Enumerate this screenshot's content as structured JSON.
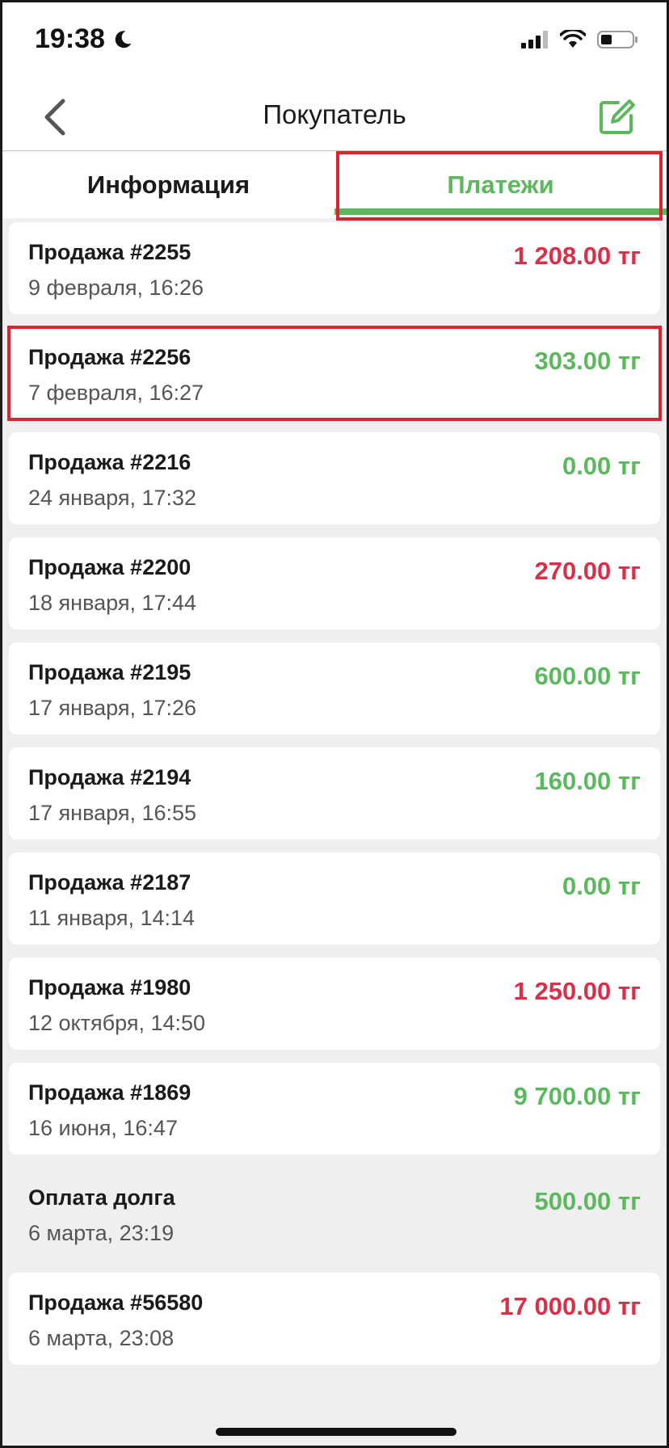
{
  "status_bar": {
    "time": "19:38"
  },
  "nav": {
    "title": "Покупатель"
  },
  "tabs": [
    {
      "label": "Информация",
      "active": false
    },
    {
      "label": "Платежи",
      "active": true
    }
  ],
  "colors": {
    "positive": "#5cb85c",
    "negative": "#d9304a",
    "accent": "#5cb85c",
    "highlight": "#d9252f"
  },
  "payments": [
    {
      "title": "Продажа #2255",
      "date": "9 февраля, 16:26",
      "amount": "1 208.00 тг",
      "status": "negative"
    },
    {
      "title": "Продажа #2256",
      "date": "7 февраля, 16:27",
      "amount": "303.00 тг",
      "status": "positive"
    },
    {
      "title": "Продажа #2216",
      "date": "24 января, 17:32",
      "amount": "0.00 тг",
      "status": "positive"
    },
    {
      "title": "Продажа #2200",
      "date": "18 января, 17:44",
      "amount": "270.00 тг",
      "status": "negative"
    },
    {
      "title": "Продажа #2195",
      "date": "17 января, 17:26",
      "amount": "600.00 тг",
      "status": "positive"
    },
    {
      "title": "Продажа #2194",
      "date": "17 января, 16:55",
      "amount": "160.00 тг",
      "status": "positive"
    },
    {
      "title": "Продажа #2187",
      "date": "11 января, 14:14",
      "amount": "0.00 тг",
      "status": "positive"
    },
    {
      "title": "Продажа #1980",
      "date": "12 октября, 14:50",
      "amount": "1 250.00 тг",
      "status": "negative"
    },
    {
      "title": "Продажа #1869",
      "date": "16 июня, 16:47",
      "amount": "9 700.00 тг",
      "status": "positive"
    },
    {
      "title": "Оплата долга",
      "date": "6 марта, 23:19",
      "amount": "500.00 тг",
      "status": "positive"
    },
    {
      "title": "Продажа #56580",
      "date": "6 марта, 23:08",
      "amount": "17 000.00 тг",
      "status": "negative"
    }
  ]
}
